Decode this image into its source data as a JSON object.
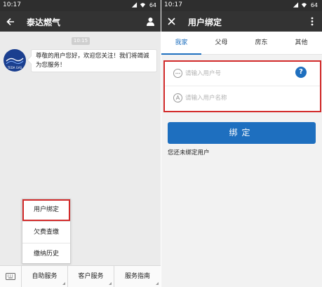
{
  "left": {
    "status": {
      "time": "10:17",
      "battery": "64"
    },
    "header": {
      "title": "泰达燃气",
      "back_icon": "back-arrow-icon",
      "profile_icon": "person-icon"
    },
    "chat": {
      "timestamp": "10:15",
      "avatar_caption": "TEDA GAS",
      "message": "尊敬的用户您好，欢迎您关注！我们将竭诚为您服务！"
    },
    "popup_menu": {
      "items": [
        {
          "label": "用户绑定",
          "highlighted": true
        },
        {
          "label": "欠费查缴"
        },
        {
          "label": "缴纳历史"
        }
      ]
    },
    "bottom_menu": {
      "keyboard_icon": "keyboard-icon",
      "items": [
        {
          "label": "自助服务"
        },
        {
          "label": "客户服务"
        },
        {
          "label": "服务指南"
        }
      ]
    }
  },
  "right": {
    "status": {
      "time": "10:17",
      "battery": "64"
    },
    "header": {
      "title": "用户绑定",
      "close_icon": "close-icon",
      "more_icon": "more-vertical-icon"
    },
    "tabs": [
      {
        "label": "我家",
        "active": true
      },
      {
        "label": "父母"
      },
      {
        "label": "房东"
      },
      {
        "label": "其他"
      }
    ],
    "form": {
      "user_id": {
        "value": "",
        "placeholder": "请输入用户号"
      },
      "user_name": {
        "value": "",
        "placeholder": "请输入用户名称"
      },
      "help_label": "?"
    },
    "bind_button": "绑定",
    "status_text": "您还未绑定用户"
  },
  "colors": {
    "accent": "#1e6fbf",
    "highlight": "#d22a2a",
    "titlebar": "#333333"
  }
}
